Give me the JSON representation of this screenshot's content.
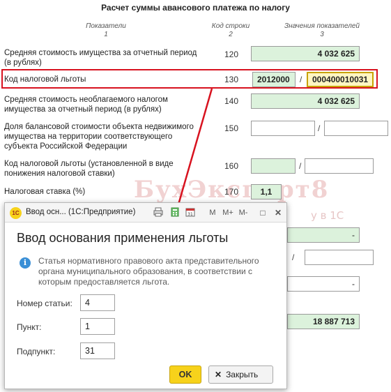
{
  "title": "Расчет суммы авансового платежа по налогу",
  "headers": {
    "col1": "Показатели",
    "col1_num": "1",
    "col2": "Код строки",
    "col2_num": "2",
    "col3": "Значения показателей",
    "col3_num": "3"
  },
  "rows": [
    {
      "label_lines": [
        "Средняя стоимость имущества за отчетный период",
        "(в рублях)"
      ],
      "code": "120",
      "value": "4 032 625"
    },
    {
      "label_lines": [
        "Код налоговой льготы"
      ],
      "code": "130",
      "value_a": "2012000",
      "sep": "/",
      "value_b": "000400010031"
    },
    {
      "label_lines": [
        "Средняя стоимость необлагаемого налогом",
        "имущества за отчетный период (в рублях)"
      ],
      "code": "140",
      "value": "4 032 625"
    },
    {
      "label_lines": [
        "Доля балансовой стоимости объекта недвижимого",
        "имущества на территории соответствующего",
        "субъекта Российской Федерации"
      ],
      "code": "150",
      "sep": "/"
    },
    {
      "label_lines": [
        "Код налоговой льготы (установленной в виде",
        "понижения налоговой ставки)"
      ],
      "code": "160",
      "sep": "/"
    },
    {
      "label_lines": [
        "Налоговая ставка (%)"
      ],
      "code": "170",
      "value": "1,1"
    }
  ],
  "hidden_fields": {
    "dash1": "-",
    "sep": "/",
    "dash2": "-",
    "total": "18 887 713"
  },
  "watermark": {
    "main": "БухЭксперт8",
    "sub": "у в 1С"
  },
  "dialog": {
    "window_title": "Ввод осн... (1С:Предприятие)",
    "logo": "1С",
    "toolbar": {
      "m": "M",
      "mplus": "M+",
      "mminus": "M-",
      "max": "□",
      "close": "✕"
    },
    "heading": "Ввод основания применения льготы",
    "info": "Статья нормативного правового акта представительного органа муниципального образования, в соответствии с которым предоставляется льгота.",
    "fields": [
      {
        "label": "Номер статьи:",
        "value": "4"
      },
      {
        "label": "Пункт:",
        "value": "1"
      },
      {
        "label": "Подпункт:",
        "value": "31"
      }
    ],
    "ok_label": "OK",
    "close_label": "Закрыть"
  },
  "colors": {
    "highlight": "#d8121f",
    "green_field": "#dcf2dc",
    "yellow_field": "#fff6c2",
    "accent": "#f7d21b"
  }
}
